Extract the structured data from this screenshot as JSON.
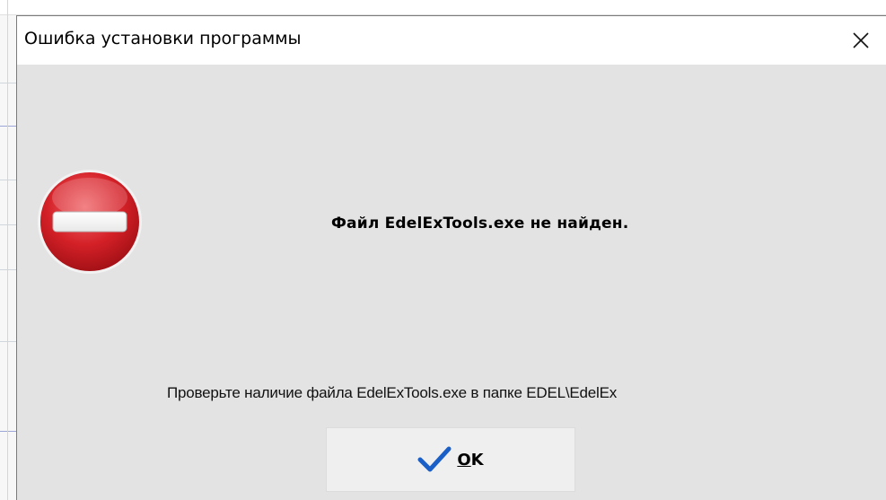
{
  "window": {
    "title": "Ошибка установки программы",
    "close_symbol": "✕"
  },
  "icon": {
    "name": "stop-icon",
    "color": "#d42027"
  },
  "message": {
    "main": "Файл EdelExTools.exe не найден.",
    "detail": "Проверьте наличие файла EdelExTools.exe в папке EDEL\\EdelEx"
  },
  "ok_button": {
    "label_mnemonic": "O",
    "label_rest": "K",
    "icon": "checkmark-icon",
    "icon_color": "#1a5fc8"
  }
}
